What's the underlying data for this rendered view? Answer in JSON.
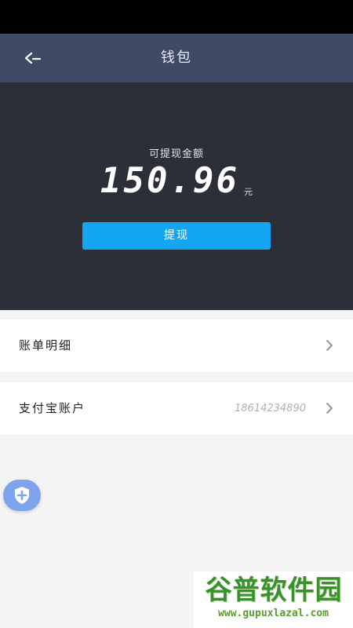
{
  "header": {
    "title": "钱包",
    "back_icon": "back-arrow-icon"
  },
  "balance": {
    "label": "可提现金额",
    "amount": "150.96",
    "unit": "元",
    "withdraw_label": "提现"
  },
  "list": {
    "bills_label": "账单明细",
    "alipay_label": "支付宝账户",
    "alipay_value": "18614234890"
  },
  "watermark": {
    "brand": "谷普软件园",
    "url": "www.gupuxlazal.com"
  },
  "colors": {
    "header_bg": "#3e4a66",
    "panel_bg": "#2c2f38",
    "accent": "#14a6f2",
    "page_bg": "#f4f4f4"
  }
}
